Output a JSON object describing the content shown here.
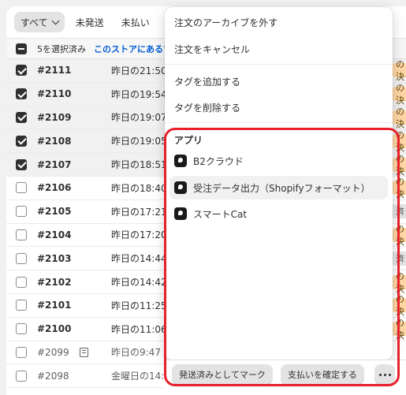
{
  "tabs": [
    {
      "label": "すべて"
    },
    {
      "label": "未発送"
    },
    {
      "label": "未払い"
    }
  ],
  "bulk": {
    "count_text": "5を選択済み",
    "link_text": "このストアにあるす"
  },
  "orders": [
    {
      "id": "#2111",
      "date": "昨日の21:50",
      "selected": true,
      "badge": "の決",
      "badge_style": "orange"
    },
    {
      "id": "#2110",
      "date": "昨日の19:54",
      "selected": true,
      "badge": "の決",
      "badge_style": "orange"
    },
    {
      "id": "#2109",
      "date": "昨日の19:07",
      "selected": true,
      "badge": "の決",
      "badge_style": "orange"
    },
    {
      "id": "#2108",
      "date": "昨日の19:05",
      "selected": true,
      "badge": "の決",
      "badge_style": "orange"
    },
    {
      "id": "#2107",
      "date": "昨日の18:51",
      "selected": true,
      "badge": "の決",
      "badge_style": "orange"
    },
    {
      "id": "#2106",
      "date": "昨日の18:40",
      "selected": false,
      "badge": "の決",
      "badge_style": "orange"
    },
    {
      "id": "#2105",
      "date": "昨日の17:21",
      "selected": false,
      "badge": "済",
      "badge_style": "gray"
    },
    {
      "id": "#2104",
      "date": "昨日の17:20",
      "selected": false,
      "badge": "の決",
      "badge_style": "orange"
    },
    {
      "id": "#2103",
      "date": "昨日の14:44",
      "selected": false,
      "badge": "済",
      "badge_style": "gray"
    },
    {
      "id": "#2102",
      "date": "昨日の14:42",
      "selected": false,
      "badge": "の決",
      "badge_style": "orange"
    },
    {
      "id": "#2101",
      "date": "昨日の11:25",
      "selected": false,
      "badge": "の決",
      "badge_style": "orange"
    },
    {
      "id": "#2100",
      "date": "昨日の11:06",
      "selected": false,
      "badge": "の決",
      "badge_style": "orange"
    },
    {
      "id": "#2099",
      "date": "昨日の9:47",
      "selected": false,
      "badge": "",
      "badge_style": "none"
    },
    {
      "id": "#2098",
      "date": "金曜日の14:2",
      "selected": false,
      "badge": "",
      "badge_style": "none"
    }
  ],
  "menu": {
    "items": [
      {
        "label": "注文のアーカイブを外す"
      },
      {
        "label": "注文をキャンセル"
      },
      {
        "label": "タグを追加する"
      },
      {
        "label": "タグを削除する"
      }
    ],
    "apps_title": "アプリ",
    "apps": [
      {
        "label": "B2クラウド",
        "icon": "app-icon"
      },
      {
        "label": "受注データ出力（Shopifyフォーマット）",
        "icon": "app-icon"
      },
      {
        "label": "スマートCat",
        "icon": "app-icon"
      }
    ]
  },
  "actions": {
    "mark_fulfilled": "発送済みとしてマーク",
    "capture_payment": "支払いを確定する"
  },
  "colors": {
    "highlight": "#e8202a",
    "link": "#005bd3",
    "badge_orange": "#ffd6a4"
  }
}
